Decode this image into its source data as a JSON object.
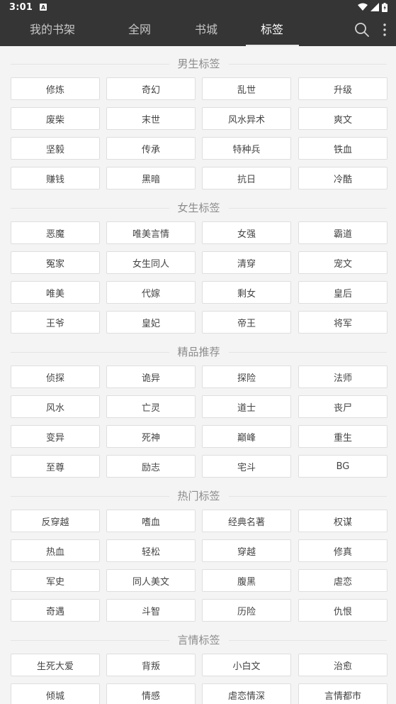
{
  "status_bar": {
    "time": "3:01",
    "notification_badge": "A"
  },
  "nav": {
    "tabs": [
      {
        "label": "我的书架",
        "active": false
      },
      {
        "label": "全网",
        "active": false
      },
      {
        "label": "书城",
        "active": false
      },
      {
        "label": "标签",
        "active": true
      }
    ],
    "icons": [
      "search-icon",
      "more-vertical-icon"
    ]
  },
  "sections": [
    {
      "title": "男生标签",
      "tags": [
        "修炼",
        "奇幻",
        "乱世",
        "升级",
        "废柴",
        "末世",
        "风水异术",
        "爽文",
        "坚毅",
        "传承",
        "特种兵",
        "铁血",
        "赚钱",
        "黑暗",
        "抗日",
        "冷酷"
      ]
    },
    {
      "title": "女生标签",
      "tags": [
        "恶魔",
        "唯美言情",
        "女强",
        "霸道",
        "冤家",
        "女生同人",
        "清穿",
        "宠文",
        "唯美",
        "代嫁",
        "剩女",
        "皇后",
        "王爷",
        "皇妃",
        "帝王",
        "将军"
      ]
    },
    {
      "title": "精品推荐",
      "tags": [
        "侦探",
        "诡异",
        "探险",
        "法师",
        "风水",
        "亡灵",
        "道士",
        "丧尸",
        "变异",
        "死神",
        "巅峰",
        "重生",
        "至尊",
        "励志",
        "宅斗",
        "BG"
      ]
    },
    {
      "title": "热门标签",
      "tags": [
        "反穿越",
        "嗜血",
        "经典名著",
        "权谋",
        "热血",
        "轻松",
        "穿越",
        "修真",
        "军史",
        "同人美文",
        "腹黑",
        "虐恋",
        "奇遇",
        "斗智",
        "历险",
        "仇恨"
      ]
    },
    {
      "title": "言情标签",
      "tags": [
        "生死大爱",
        "背叛",
        "小白文",
        "治愈",
        "倾城",
        "情感",
        "虐恋情深",
        "言情都市"
      ]
    }
  ],
  "colors": {
    "nav_background": "#353535",
    "page_background": "#f4f4f4",
    "tag_border": "#dedede"
  }
}
